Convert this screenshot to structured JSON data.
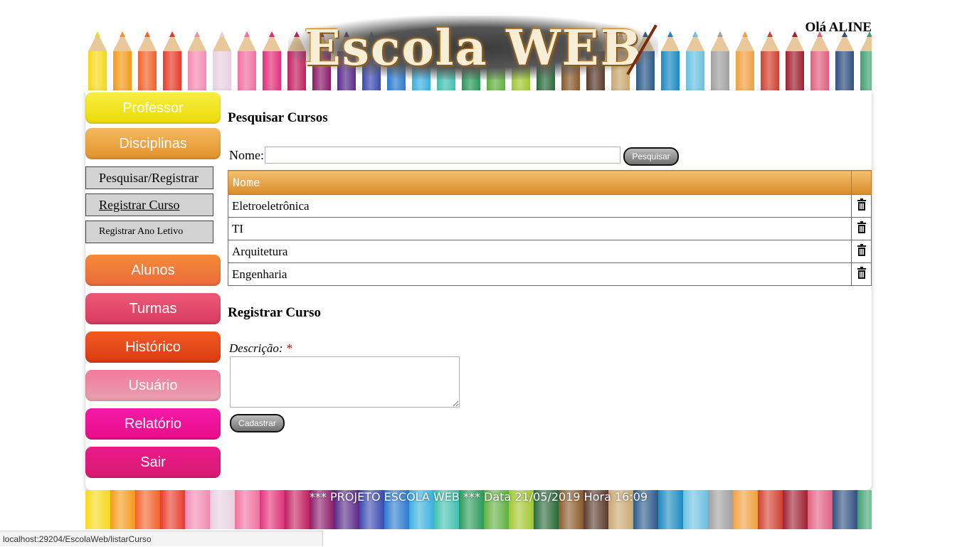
{
  "header": {
    "logo_text": "Escola WEB",
    "greeting": "Olá ALINE"
  },
  "sidebar": {
    "professor": {
      "label": "Professor",
      "color": "#f3e31a"
    },
    "disciplinas": {
      "label": "Disciplinas",
      "color": "#e9a53d"
    },
    "submenu": [
      {
        "label": "Pesquisar/Registrar"
      },
      {
        "label": "Registrar Curso"
      },
      {
        "label": "Registrar Ano Letivo"
      }
    ],
    "alunos": {
      "label": "Alunos",
      "color": "#f07a3c"
    },
    "turmas": {
      "label": "Turmas",
      "color": "#df4a6a"
    },
    "historico": {
      "label": "Histórico",
      "color": "#e44418"
    },
    "usuario": {
      "label": "Usuário",
      "color": "#ef8aa2"
    },
    "relatorio": {
      "label": "Relatório",
      "color": "#f2129a"
    },
    "sair": {
      "label": "Sair",
      "color": "#e2177f"
    }
  },
  "search": {
    "title": "Pesquisar Cursos",
    "name_label": "Nome:",
    "name_value": "",
    "button": "Pesquisar"
  },
  "table": {
    "header": "Nome",
    "rows": [
      "Eletroeletrônica",
      "TI",
      "Arquitetura",
      "Engenharia"
    ],
    "row_icon": "trash-icon"
  },
  "register": {
    "title": "Registrar Curso",
    "desc_label": "Descrição:",
    "required_mark": "*",
    "button": "Cadastrar"
  },
  "footer": {
    "text": "*** PROJETO ESCOLA WEB *** Data 21/05/2019 Hora 16:09"
  },
  "statusbar": {
    "url": "localhost:29204/EscolaWeb/listarCurso"
  },
  "colors": {
    "pencils": [
      "#f7d81a",
      "#f39a1a",
      "#f0622a",
      "#e83a2a",
      "#f28bb0",
      "#e8d0e0",
      "#f070a0",
      "#e0307a",
      "#c02060",
      "#8a1a6a",
      "#5a2a8a",
      "#3a4ab0",
      "#2a7ad0",
      "#3ab0e0",
      "#40c0b0",
      "#2a9a5a",
      "#60b040",
      "#a0c830",
      "#2a6a3a",
      "#8a5a2a",
      "#5a3a2a",
      "#c8a870",
      "#2a5a8a",
      "#1a8ac0",
      "#6ac0e0",
      "#a0a0a0",
      "#f0a040",
      "#d04030",
      "#a02030",
      "#e06080",
      "#305080",
      "#40a070"
    ]
  }
}
